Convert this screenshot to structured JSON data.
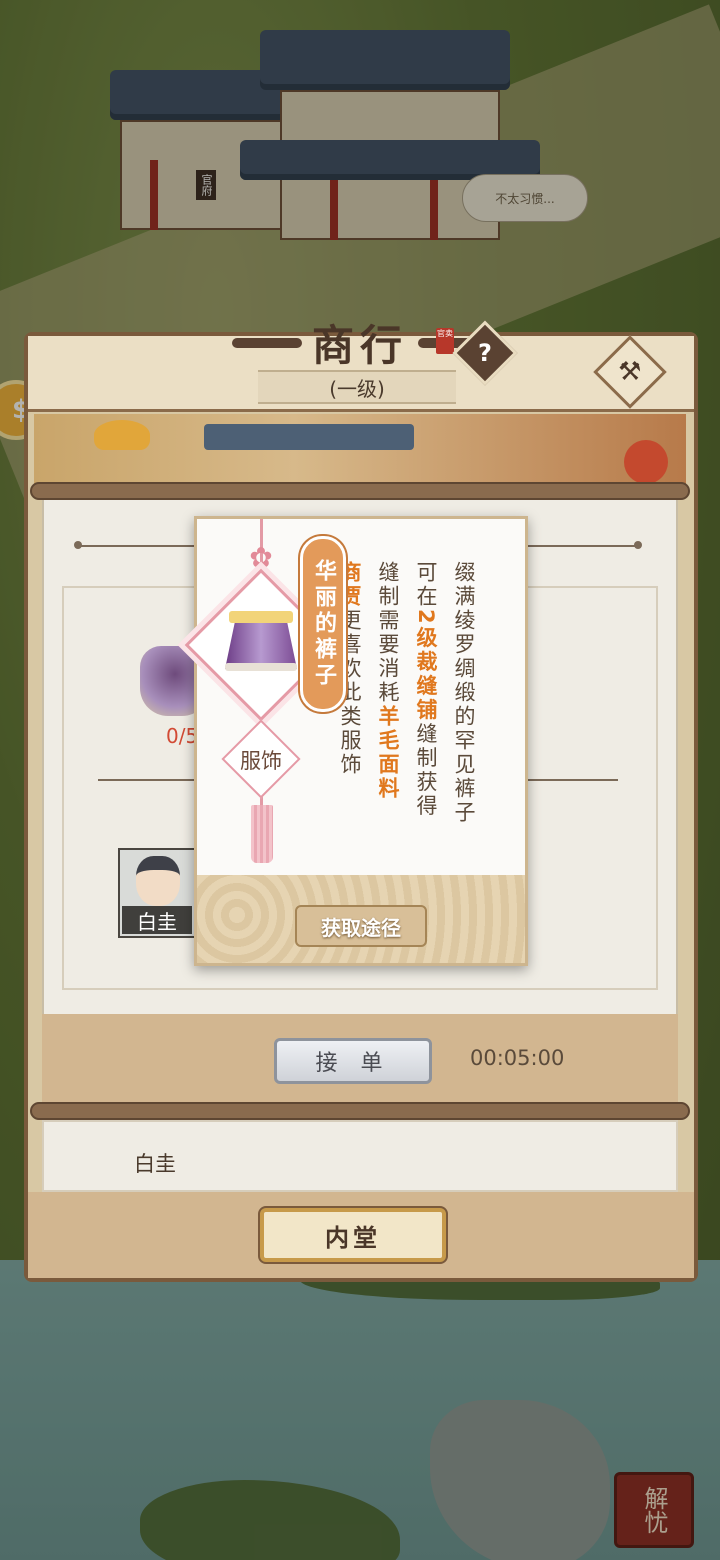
{
  "world": {
    "speech_bubble": "不太习惯...",
    "building_sign": "官府",
    "badge": "解忧"
  },
  "panel": {
    "title": "商行",
    "title_seal": "官卖",
    "level": "(一级)",
    "help_symbol": "?",
    "hammer_symbol": "⚒"
  },
  "order": {
    "count": "0/5",
    "customer_name": "白圭",
    "accept_label": "接 单",
    "timer": "00:05:00",
    "secondary_name": "白圭",
    "hall_button": "内堂"
  },
  "item_popup": {
    "name": "华丽的裤子",
    "category": "服饰",
    "source_button": "获取途径",
    "description_col1": "缀满绫罗绸缎的罕见裤子",
    "description_col2_a": "可在",
    "description_col2_hl": "2级裁缝铺",
    "description_col2_b": "缝制获得",
    "description_col3_a": "缝制需要消耗",
    "description_col3_hl": "羊毛面料",
    "description_col4_hl": "商贾",
    "description_col4_b": "更喜欢此类服饰"
  },
  "colors": {
    "highlight": "#e0781e",
    "name_tag": "#e39a5a",
    "accent_pink": "#e59aa6"
  }
}
